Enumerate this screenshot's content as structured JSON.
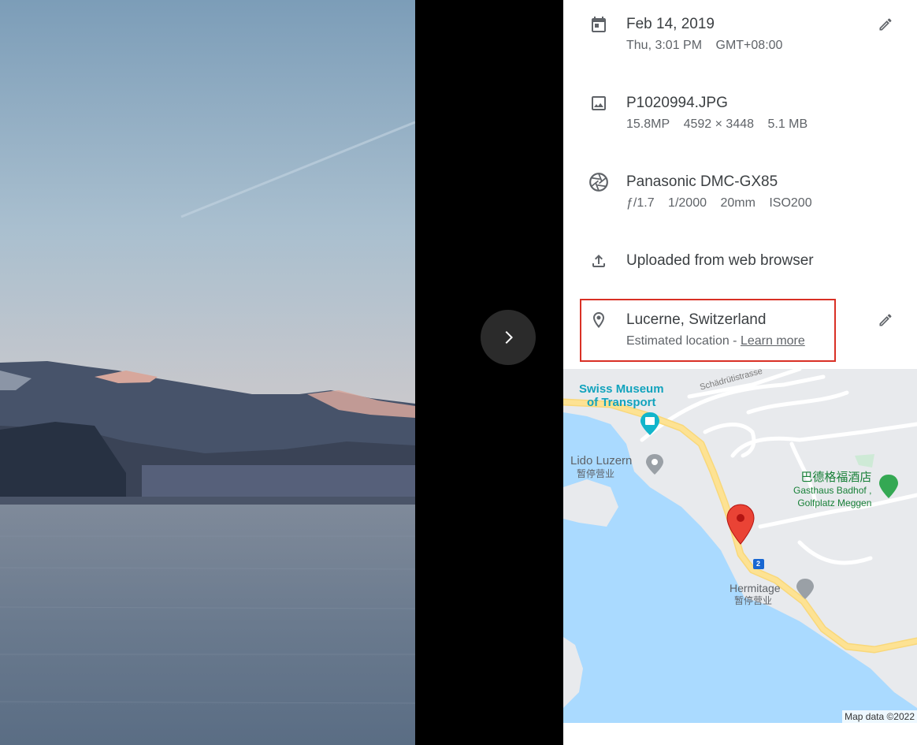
{
  "photo": {
    "alt": "Lake landscape at dusk"
  },
  "viewer": {
    "next_icon": "chevron-right-icon"
  },
  "details": {
    "date": {
      "icon": "calendar-icon",
      "title": "Feb 14, 2019",
      "day_time": "Thu, 3:01 PM",
      "timezone": "GMT+08:00"
    },
    "file": {
      "icon": "image-icon",
      "title": "P1020994.JPG",
      "megapixels": "15.8MP",
      "resolution": "4592 × 3448",
      "size": "5.1 MB"
    },
    "camera": {
      "icon": "aperture-icon",
      "title": "Panasonic DMC-GX85",
      "aperture": "ƒ/1.7",
      "shutter": "1/2000",
      "focal": "20mm",
      "iso": "ISO200"
    },
    "upload": {
      "icon": "upload-icon",
      "title": "Uploaded from web browser"
    },
    "location": {
      "icon": "location-pin-icon",
      "title": "Lucerne, Switzerland",
      "subtitle": "Estimated location - ",
      "link": "Learn more",
      "highlight_color": "#d93025"
    }
  },
  "map": {
    "labels": {
      "museum_line1": "Swiss Museum",
      "museum_line2": "of Transport",
      "street": "Schädrütistrasse",
      "lido": "Lido Luzern",
      "lido_status": "暂停营业",
      "hotel_cn": "巴德格福酒店",
      "hotel_line1": "Gasthaus Badhof ,",
      "hotel_line2": "Golfplatz Meggen",
      "hermitage": "Hermitage",
      "hermitage_status": "暂停营业",
      "road_number": "2"
    },
    "credit": "Map data ©2022",
    "colors": {
      "water": "#aadaff",
      "land": "#e8eaed",
      "road": "#fde293",
      "pin": "#ea4335",
      "poi_green": "#34a853",
      "poi_teal": "#12b5cb"
    }
  }
}
